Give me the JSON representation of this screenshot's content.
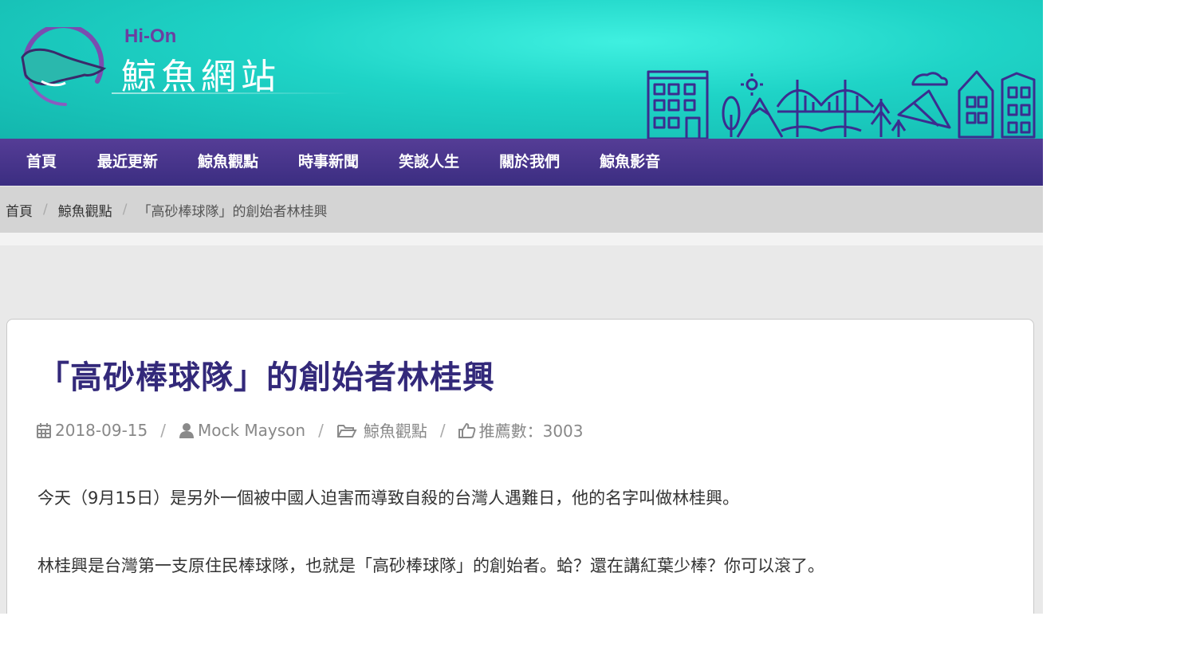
{
  "header": {
    "brand_sub": "Hi-On",
    "brand_title": "鯨魚網站",
    "colors": {
      "teal": "#1fd4c7",
      "purple": "#553d96",
      "title": "#33297a"
    }
  },
  "nav": {
    "items": [
      {
        "label": "首頁"
      },
      {
        "label": "最近更新"
      },
      {
        "label": "鯨魚觀點"
      },
      {
        "label": "時事新聞"
      },
      {
        "label": "笑談人生"
      },
      {
        "label": "關於我們"
      },
      {
        "label": "鯨魚影音"
      }
    ]
  },
  "breadcrumb": {
    "items": [
      "首頁",
      "鯨魚觀點"
    ],
    "separator": "/",
    "current": "「高砂棒球隊」的創始者林桂興"
  },
  "article": {
    "title": "「高砂棒球隊」的創始者林桂興",
    "meta": {
      "date": "2018-09-15",
      "author": "Mock Mayson",
      "category": "鯨魚觀點",
      "likes": "推薦數：3003",
      "separator": "/",
      "icons": [
        "calendar-icon",
        "user-icon",
        "folder-icon",
        "thumbs-up-icon"
      ]
    },
    "paragraphs": [
      "今天（9月15日）是另外一個被中國人迫害而導致自殺的台灣人遇難日，他的名字叫做林桂興。",
      "林桂興是台灣第一支原住民棒球隊，也就是「高砂棒球隊」的創始者。蛤？還在講紅葉少棒？你可以滾了。"
    ]
  }
}
